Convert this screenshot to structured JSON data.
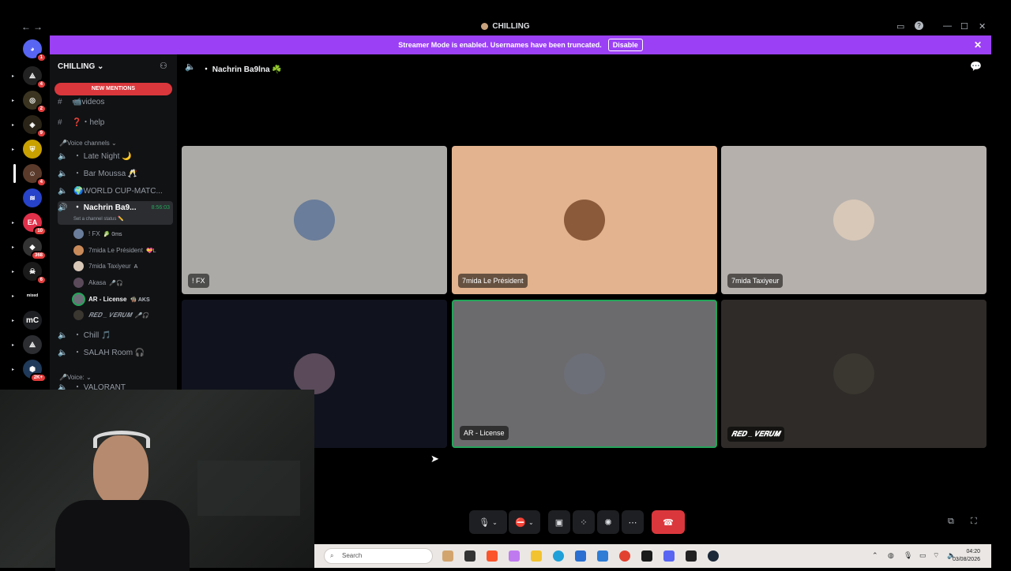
{
  "window": {
    "title": "CHILLING",
    "back": "←",
    "forward": "→"
  },
  "banner": {
    "text": "Streamer Mode is enabled. Usernames have been truncated.",
    "button": "Disable",
    "close": "✕"
  },
  "rail_badges": [
    "1",
    "4",
    "2",
    "9",
    "4",
    "10",
    "368",
    "6",
    "2K+"
  ],
  "rail_text": {
    "mc": "mC",
    "mixed": "mixed"
  },
  "sidebar": {
    "server_name": "CHILLING",
    "new_mentions": "NEW MENTIONS",
    "text_channels": [
      {
        "icon": "📹",
        "name": "videos"
      },
      {
        "icon": "❓",
        "name": "・help"
      }
    ],
    "voice_category": "🎤Voice channels",
    "voice_channels": [
      {
        "name": "・ Late Night 🌙"
      },
      {
        "name": "・ Bar Moussa 🥂"
      },
      {
        "name": "🌍WORLD CUP-MATC..."
      }
    ],
    "active_channel": {
      "name": "・ Nachrin Ba9...",
      "timer": "8:56:03",
      "status": "Set a channel status ✏️"
    },
    "members": [
      {
        "name": "! FX",
        "tag": "🥬 0ms"
      },
      {
        "name": "7mida Le Président",
        "tag": "💝L"
      },
      {
        "name": "7mida Taxiyeur",
        "tag": "A"
      },
      {
        "name": "Akasa",
        "tag": "🎤🎧"
      },
      {
        "name": "AR - License",
        "tag": "🧌 AKS"
      },
      {
        "name": "𝑹𝑬𝑫 _ 𝑽𝑬𝑹𝑼𝑴",
        "tag": "🎤🎧"
      }
    ],
    "more_channels": [
      {
        "name": "・ Chill 🎵"
      },
      {
        "name": "・ SALAH Room 🎧"
      }
    ],
    "voice2_category": "🎤Voice:",
    "partial_channel": "・ VALORANT"
  },
  "header": {
    "channel": "・ Nachrin Ba9lna ☘️"
  },
  "tiles": [
    {
      "label": "! FX",
      "bg": "#acaaa6",
      "avatar": "#6a7d9a"
    },
    {
      "label": "7mida Le Président",
      "bg": "#e2b38e",
      "avatar": "#8a5a3a"
    },
    {
      "label": "7mida Taxiyeur",
      "bg": "#b5b0ac",
      "avatar": "#d8c8b8"
    },
    {
      "label": "",
      "bg": "#10131d",
      "avatar": "#5a4a5a"
    },
    {
      "label": "AR - License",
      "bg": "#6b6b6e",
      "avatar": "#6d6f78"
    },
    {
      "label": "𝑹𝑬𝑫 _ 𝑽𝑬𝑹𝑼𝑴",
      "bg": "#2e2b28",
      "avatar": "#3a3630"
    }
  ],
  "taskbar": {
    "search_placeholder": "Search",
    "time": "04:20",
    "date": "03/08/2026"
  },
  "colors": {
    "accent": "#9b40f5",
    "speaking": "#23a559",
    "hangup": "#da373c"
  }
}
